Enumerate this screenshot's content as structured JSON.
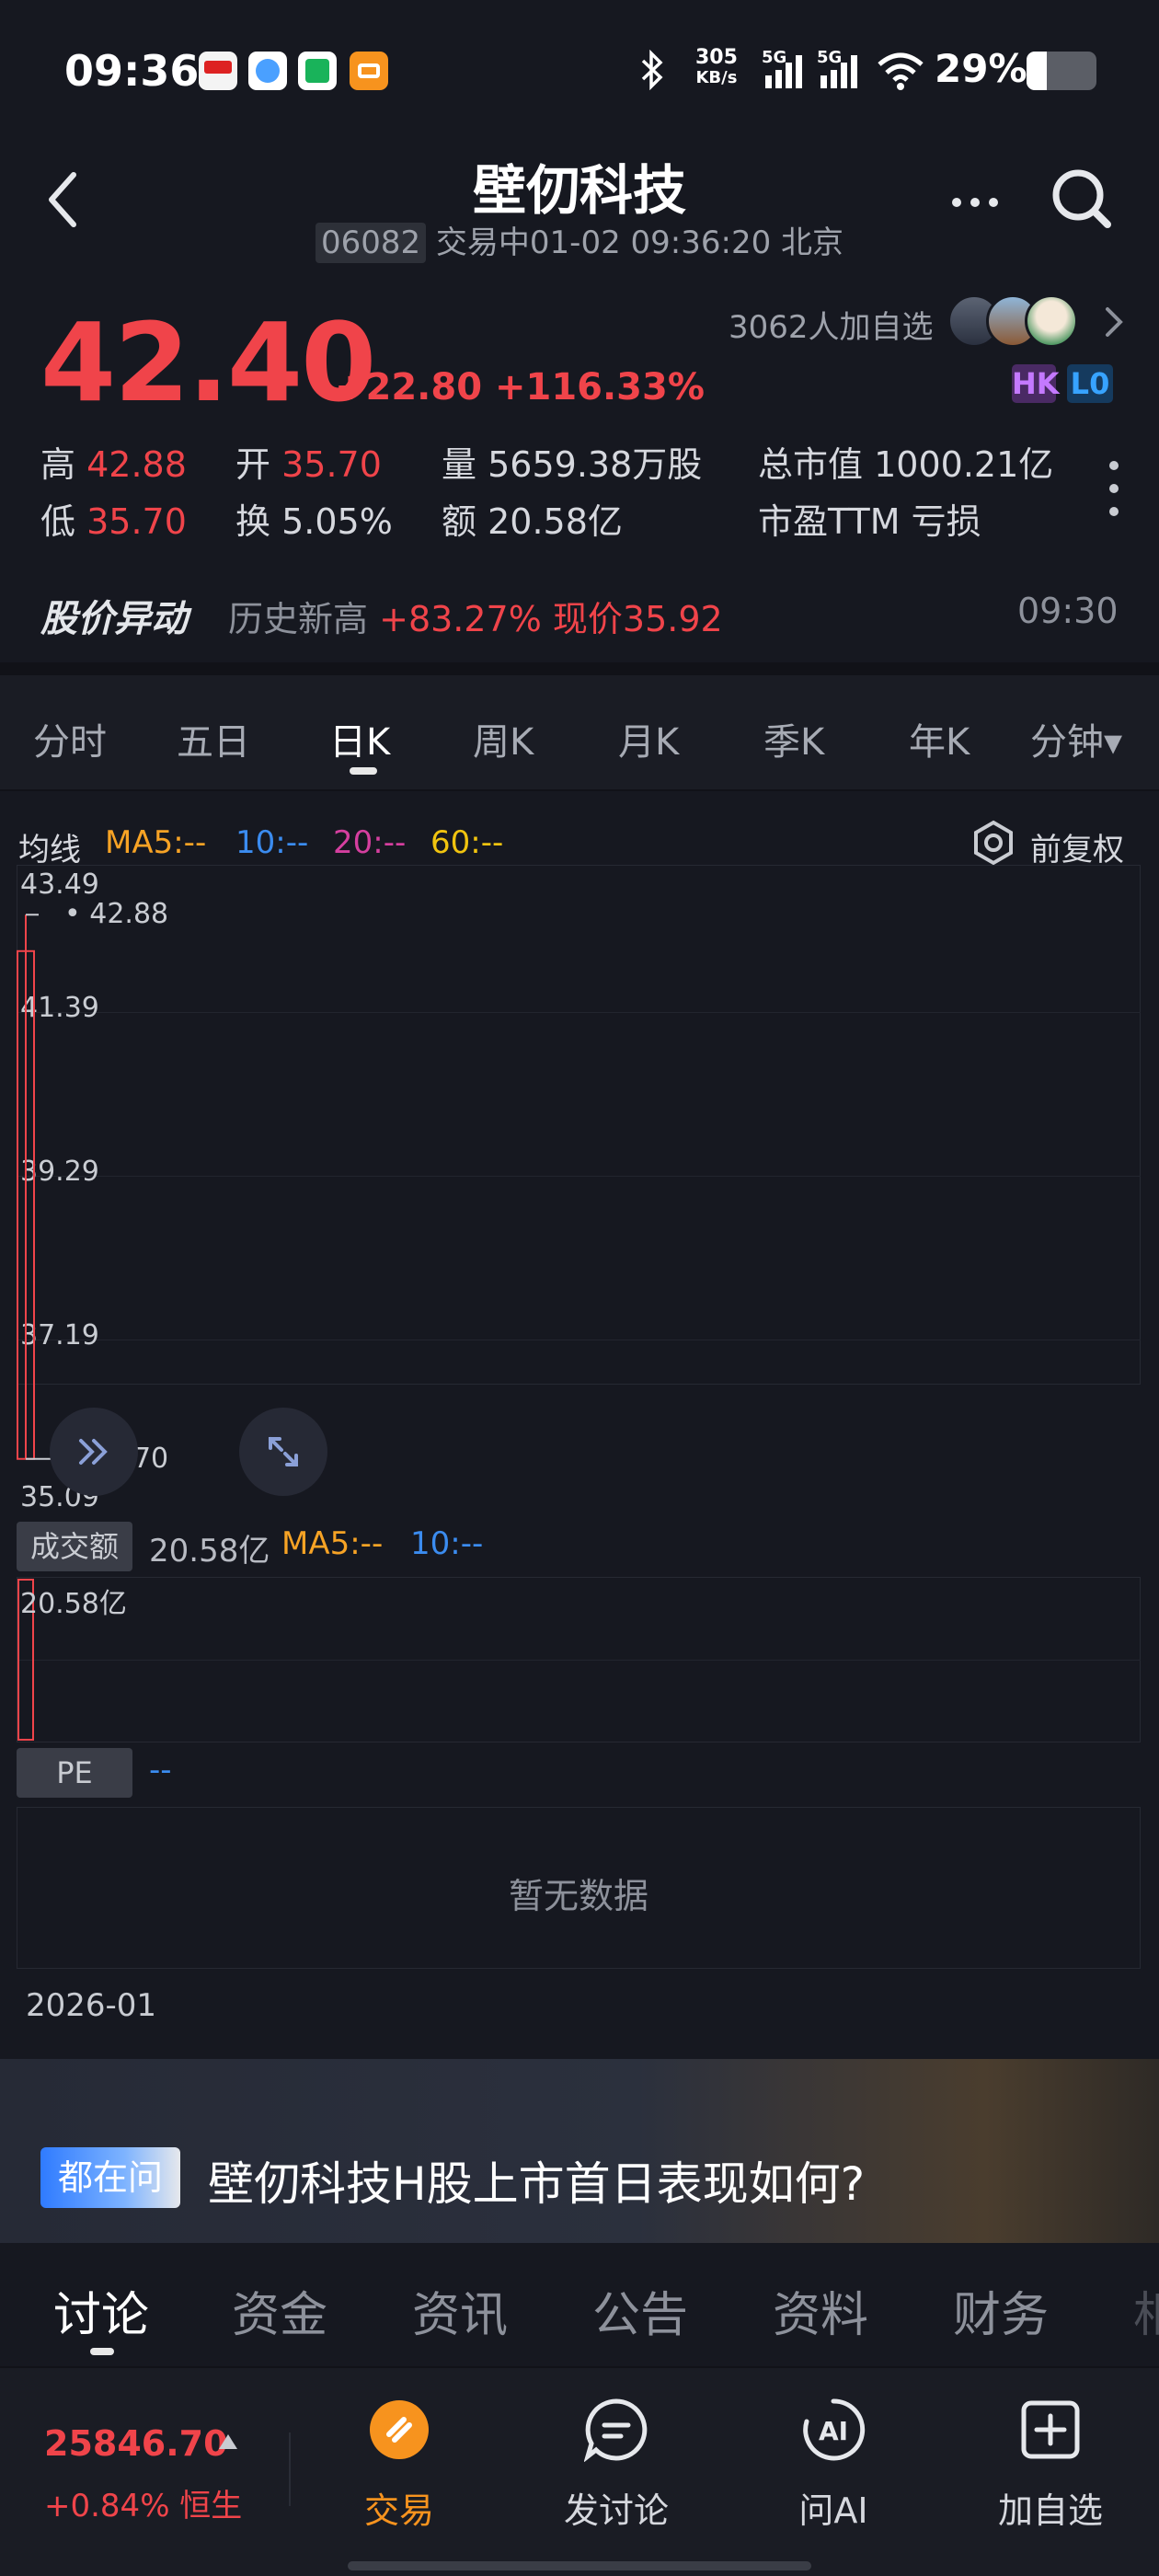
{
  "status_bar": {
    "time": "09:36",
    "net_speed_value": "305",
    "net_speed_unit": "KB/s",
    "sig1": "5G",
    "sig2": "5G",
    "battery": "29%"
  },
  "header": {
    "title": "壁仞科技",
    "code": "06082",
    "status_text": "交易中01-02 09:36:20 北京"
  },
  "quote": {
    "price": "42.40",
    "change": "+22.80 +116.33%",
    "followers": "3062人加自选",
    "badges": [
      "HK",
      "L0"
    ],
    "stats": [
      {
        "label": "高",
        "value": "42.88",
        "red": true
      },
      {
        "label": "开",
        "value": "35.70",
        "red": true
      },
      {
        "label": "量",
        "value": "5659.38万股",
        "red": false
      },
      {
        "label": "总市值",
        "value": "1000.21亿",
        "red": false
      },
      {
        "label": "低",
        "value": "35.70",
        "red": true
      },
      {
        "label": "换",
        "value": "5.05%",
        "red": false
      },
      {
        "label": "额",
        "value": "20.58亿",
        "red": false
      },
      {
        "label": "市盈TTM",
        "value": "亏损",
        "red": false
      }
    ]
  },
  "alert": {
    "label": "股价异动",
    "event": "历史新高",
    "detail": "+83.27% 现价35.92",
    "time": "09:30"
  },
  "period_tabs": [
    "分时",
    "五日",
    "日K",
    "周K",
    "月K",
    "季K",
    "年K",
    "分钟▾"
  ],
  "active_period": "日K",
  "chart": {
    "ma_title": "均线",
    "ma5": "MA5:--",
    "ma10": "10:--",
    "ma20": "20:--",
    "ma60": "60:--",
    "adjust_label": "前复权",
    "y_labels": [
      "43.49",
      "41.39",
      "39.29",
      "37.19",
      "35.09"
    ],
    "high_marker": "42.88",
    "low_marker": "35.70",
    "volume_label": "成交额",
    "volume_value": "20.58亿",
    "volume_ma5": "MA5:--",
    "volume_ma10": "10:--",
    "volume_axis": "20.58亿",
    "pe_label": "PE",
    "pe_value": "--",
    "no_data": "暂无数据",
    "date_label": "2026-01"
  },
  "chart_data": {
    "type": "candlestick",
    "categories": [
      "2026-01-02"
    ],
    "series": [
      {
        "open": 35.7,
        "high": 42.88,
        "low": 35.7,
        "close": 42.4,
        "turnover": "20.58亿"
      }
    ],
    "ylim": [
      35.09,
      43.49
    ]
  },
  "banner": {
    "badge": "都在问",
    "question": "壁仞科技H股上市首日表现如何?"
  },
  "bottom_tabs": [
    "讨论",
    "资金",
    "资讯",
    "公告",
    "资料",
    "财务",
    "相"
  ],
  "active_bottom_tab": "讨论",
  "index": {
    "value": "25846.70",
    "change": "+0.84% 恒生"
  },
  "nav": {
    "trade": "交易",
    "discuss": "发讨论",
    "ask_ai": "问AI",
    "add_watch": "加自选"
  },
  "colors": {
    "up_red": "#f0444a",
    "ma5": "#f7a325",
    "ma10": "#3b8cf0",
    "ma20": "#d53f9f",
    "ma60": "#f1c40f",
    "trade_orange": "#f7931e"
  }
}
